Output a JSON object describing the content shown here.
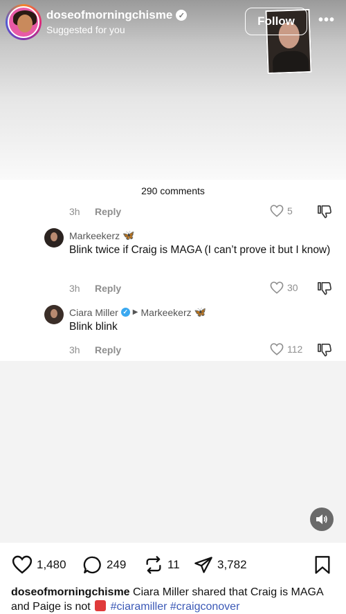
{
  "header": {
    "account_name": "doseofmorningchisme",
    "subtitle": "Suggested for you",
    "follow_label": "Follow",
    "more_label": "•••"
  },
  "comments": {
    "count_label": "290 comments",
    "items": [
      {
        "time": "3h",
        "reply_label": "Reply",
        "likes": "5"
      },
      {
        "author": "Markeekerz",
        "author_emoji": "🦋",
        "text": "Blink twice if Craig is MAGA (I can’t prove it but I know)",
        "time": "3h",
        "reply_label": "Reply",
        "likes": "30"
      },
      {
        "author": "Ciara Miller",
        "verified": true,
        "reply_to": "Markeekerz",
        "reply_to_emoji": "🦋",
        "text": "Blink blink",
        "time": "3h",
        "reply_label": "Reply",
        "likes": "112"
      }
    ]
  },
  "actions": {
    "likes": "1,480",
    "comments": "249",
    "reposts": "11",
    "shares": "3,782"
  },
  "caption": {
    "user": "doseofmorningchisme",
    "text": " Ciara Miller shared that Craig is MAGA and Paige is not ",
    "tags": "#ciaramiller #craigconover"
  },
  "icons": {
    "heart": "heart-icon",
    "comment": "comment-icon",
    "repost": "repost-icon",
    "share": "send-icon",
    "bookmark": "bookmark-icon",
    "dislike": "dislike-icon",
    "sound": "speaker-icon"
  },
  "colors": {
    "hashtag": "#3a58b6",
    "verified": "#3aa8f0",
    "text": "#111111",
    "muted": "#8e8e8e"
  }
}
